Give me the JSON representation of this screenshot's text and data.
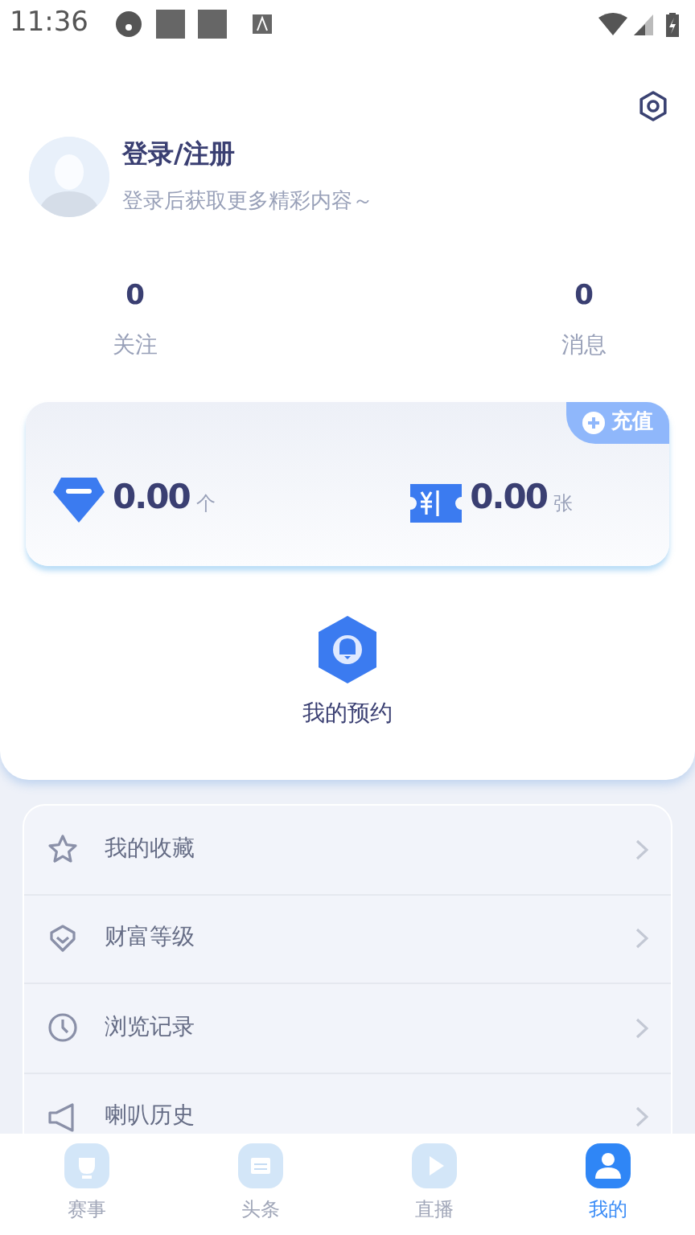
{
  "status_bar": {
    "time": "11:36"
  },
  "profile": {
    "title": "登录/注册",
    "subtitle": "登录后获取更多精彩内容～"
  },
  "stats": [
    {
      "value": "0",
      "label": "关注"
    },
    {
      "value": "0",
      "label": "消息"
    }
  ],
  "wallet": {
    "recharge": "充值",
    "items": [
      {
        "kind": "diamond",
        "amount": "0.00",
        "unit": "个"
      },
      {
        "kind": "ticket",
        "amount": "0.00",
        "unit": "张"
      }
    ]
  },
  "reservation": {
    "label": "我的预约"
  },
  "menu": [
    {
      "kind": "star",
      "label": "我的收藏"
    },
    {
      "kind": "shield",
      "label": "财富等级"
    },
    {
      "kind": "clock",
      "label": "浏览记录"
    },
    {
      "kind": "horn",
      "label": "喇叭历史"
    }
  ],
  "tabs": [
    {
      "kind": "trophy",
      "label": "赛事",
      "selected": false
    },
    {
      "kind": "news",
      "label": "头条",
      "selected": false
    },
    {
      "kind": "play",
      "label": "直播",
      "selected": false
    },
    {
      "kind": "user",
      "label": "我的",
      "selected": true
    }
  ]
}
